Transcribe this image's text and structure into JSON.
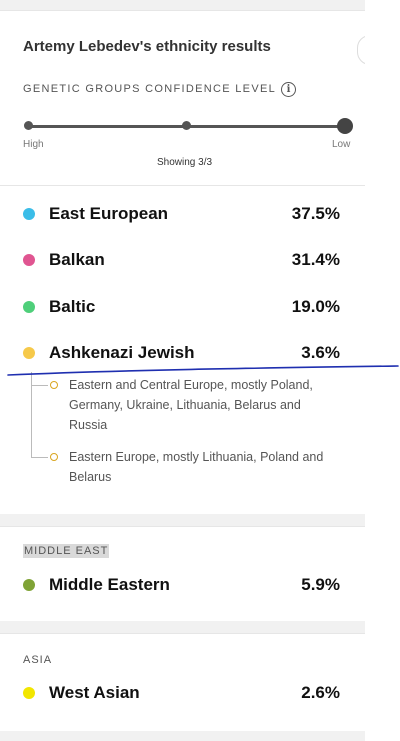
{
  "header": {
    "title": "Artemy Lebedev's ethnicity results",
    "confidence_label": "GENETIC GROUPS CONFIDENCE LEVEL",
    "info_icon": "info-icon",
    "slider": {
      "high_label": "High",
      "low_label": "Low",
      "showing_text": "Showing 3/3",
      "level": "3/3"
    }
  },
  "groups": [
    {
      "name": "East European",
      "percent": "37.5%",
      "color": "#3bbde8"
    },
    {
      "name": "Balkan",
      "percent": "31.4%",
      "color": "#e05591"
    },
    {
      "name": "Baltic",
      "percent": "19.0%",
      "color": "#4fcf7a"
    },
    {
      "name": "Ashkenazi Jewish",
      "percent": "3.6%",
      "color": "#f6c94a",
      "subregions": [
        {
          "text": "Eastern and Central Europe, mostly Poland, Germany, Ukraine, Lithuania, Belarus and Russia"
        },
        {
          "text": "Eastern Europe, mostly Lithuania, Poland and Belarus"
        }
      ]
    }
  ],
  "middle_east": {
    "region_label": "MIDDLE EAST",
    "groups": [
      {
        "name": "Middle Eastern",
        "percent": "5.9%",
        "color": "#7fa336"
      }
    ]
  },
  "asia": {
    "region_label": "ASIA",
    "groups": [
      {
        "name": "West Asian",
        "percent": "2.6%",
        "color": "#f2e600"
      }
    ]
  },
  "annotation": {
    "pen_color": "#1f2fb0"
  }
}
